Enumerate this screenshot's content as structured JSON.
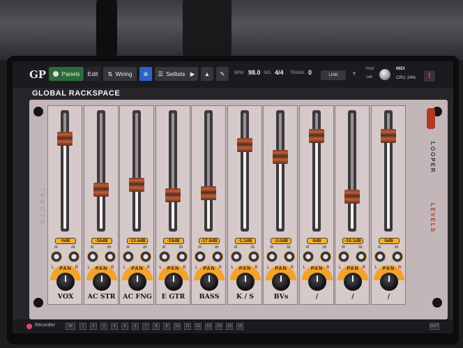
{
  "toolbar": {
    "panels_label": "Panels",
    "edit_label": "Edit",
    "wiring_label": "Wiring",
    "setlists_label": "Setlists",
    "bpm_label": "BPM",
    "bpm_value": "98.0",
    "sig_label": "SIG.",
    "sig_value": "4/4",
    "trans_label": "TRANS.",
    "trans_value": "0",
    "link_label": "LINK",
    "trim_label": "TRIM",
    "trim_value": "0dB",
    "midi_label": "MIDI",
    "cpu_label": "CPU:",
    "cpu_value": "24%",
    "alert_glyph": "!"
  },
  "rackspace": {
    "title": "GLOBAL RACKSPACE",
    "side_label": "GLOBAL",
    "looper_label": "LOOPER",
    "levels_label": "LEVELS"
  },
  "channels": [
    {
      "name": "VOX",
      "db": "0dB",
      "level": 0.78
    },
    {
      "name": "AC STR",
      "db": "-16dB",
      "level": 0.34
    },
    {
      "name": "AC FNG",
      "db": "-13.4dB",
      "level": 0.38
    },
    {
      "name": "E GTR",
      "db": "-19dB",
      "level": 0.29
    },
    {
      "name": "BASS",
      "db": "-17.8dB",
      "level": 0.31
    },
    {
      "name": "K / S",
      "db": "-1.1dB",
      "level": 0.72
    },
    {
      "name": "BVs",
      "db": "-3.0dB",
      "level": 0.62
    },
    {
      "name": "/",
      "db": "0dB",
      "level": 0.8
    },
    {
      "name": "/",
      "db": "-19.1dB",
      "level": 0.28
    },
    {
      "name": "/",
      "db": "0dB",
      "level": 0.8
    }
  ],
  "strip_labels": {
    "fx_a": "/R",
    "fx_b": "/M",
    "pan": "PAN",
    "pan_left": "L",
    "pan_right": "R"
  },
  "bottom": {
    "recorder_label": "Recorder",
    "in_label": "IN",
    "out_label": "OUT",
    "numbers": [
      "1",
      "2",
      "3",
      "4",
      "5",
      "6",
      "7",
      "8",
      "9",
      "10",
      "11",
      "12",
      "13",
      "14",
      "15",
      "16"
    ]
  },
  "colors": {
    "accent_orange": "#f1a32c",
    "fader_cap": "#c05e33",
    "panel_bg": "#c3b6b8",
    "toolbar_bg": "#1b1a1e",
    "record_dot": "#d94b6b"
  }
}
